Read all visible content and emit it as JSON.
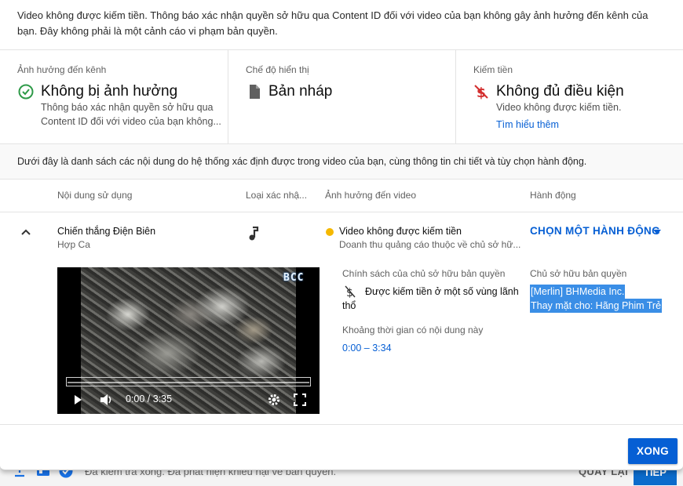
{
  "banner": "Video không được kiếm tiền. Thông báo xác nhận quyền sở hữu qua Content ID đối với video của bạn không gây ảnh hưởng đến kênh của bạn. Đây không phải là một cảnh cáo vi phạm bản quyền.",
  "cards": [
    {
      "title": "Ảnh hưởng đến kênh",
      "value": "Không bị ảnh hưởng",
      "desc_line1": "Thông báo xác nhận quyền sở hữu qua",
      "desc_line2": "Content ID đối với video của bạn không...",
      "icon": "check-circle-icon",
      "icon_color": "#2e9a48"
    },
    {
      "title": "Chế độ hiển thị",
      "value": "Bản nháp",
      "icon": "draft-document-icon",
      "icon_color": "#606060"
    },
    {
      "title": "Kiếm tiền",
      "value": "Không đủ điều kiện",
      "desc_line1": "Video không được kiếm tiền.",
      "link": "Tìm hiểu thêm",
      "icon": "no-monetization-icon",
      "icon_color": "#d32f2f"
    }
  ],
  "info_text": "Dưới đây là danh sách các nội dung do hệ thống xác định được trong video của bạn, cùng thông tin chi tiết và tùy chọn hành động.",
  "columns": [
    "Nội dung sử dụng",
    "Loại xác nhậ...",
    "Ảnh hưởng đến video",
    "Hành động"
  ],
  "row": {
    "content_title": "Chiến thắng Điện Biên",
    "content_artist": "Hợp Ca",
    "claim_type_icon": "music-note-icon",
    "impact_status": "Video không được kiếm tiền",
    "impact_status_color": "#f5b800",
    "impact_detail": "Doanh thu quảng cáo thuộc về chủ sở hữ...",
    "action_label": "CHỌN MỘT HÀNH ĐỘNG",
    "policy_heading": "Chính sách của chủ sở hữu bản quyền",
    "policy_line1": "Được kiếm tiền ở một số vùng lãnh",
    "policy_line2": "thổ",
    "duration_heading": "Khoảng thời gian có nội dung này",
    "duration_value": "0:00 – 3:34",
    "owner_heading": "Chủ sở hữu bản quyền",
    "owner_line1": "[Merlin] BHMedia Inc.",
    "owner_line2": "Thay mặt cho: Hãng Phim Trẻ"
  },
  "video": {
    "watermark": "BCC",
    "time": "0:00 / 3:35"
  },
  "done_label": "XONG",
  "footer": {
    "status_text": "Đã kiểm tra xong. Đã phát hiện khiếu nại về bản quyền.",
    "back_label": "QUAY LẠI",
    "next_label": "TIẾP"
  },
  "accent": "#065fd4"
}
